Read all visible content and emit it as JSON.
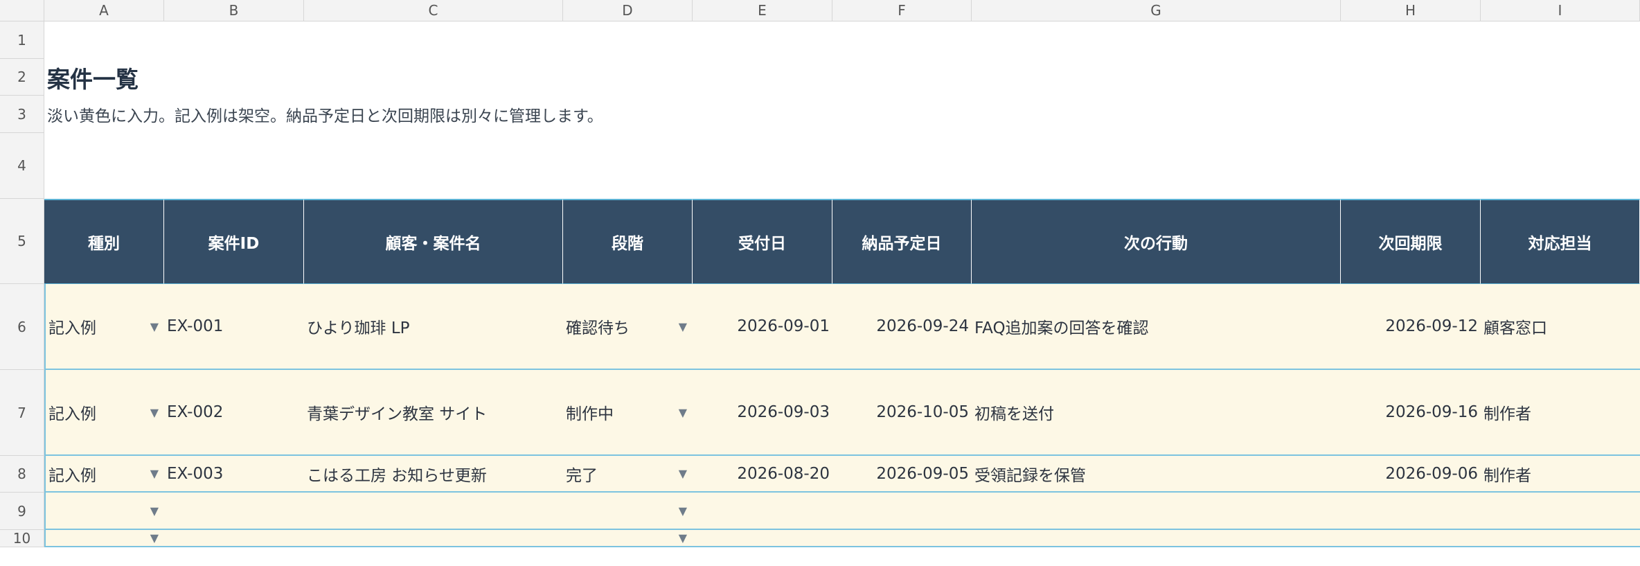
{
  "columns": [
    "A",
    "B",
    "C",
    "D",
    "E",
    "F",
    "G",
    "H",
    "I"
  ],
  "rows": [
    "1",
    "2",
    "3",
    "4",
    "5",
    "6",
    "7",
    "8",
    "9",
    "10"
  ],
  "title": "案件一覧",
  "note": "淡い黄色に入力。記入例は架空。納品予定日と次回期限は別々に管理します。",
  "headers": {
    "type": "種別",
    "case_id": "案件ID",
    "customer": "顧客・案件名",
    "stage": "段階",
    "received": "受付日",
    "delivery": "納品予定日",
    "next_action": "次の行動",
    "next_deadline": "次回期限",
    "owner": "対応担当"
  },
  "records": [
    {
      "type": "記入例",
      "case_id": "EX-001",
      "customer": "ひより珈琲 LP",
      "stage": "確認待ち",
      "received": "2026-09-01",
      "delivery": "2026-09-24",
      "next_action": "FAQ追加案の回答を確認",
      "next_deadline": "2026-09-12",
      "owner": "顧客窓口"
    },
    {
      "type": "記入例",
      "case_id": "EX-002",
      "customer": "青葉デザイン教室 サイト",
      "stage": "制作中",
      "received": "2026-09-03",
      "delivery": "2026-10-05",
      "next_action": "初稿を送付",
      "next_deadline": "2026-09-16",
      "owner": "制作者"
    },
    {
      "type": "記入例",
      "case_id": "EX-003",
      "customer": "こはる工房 お知らせ更新",
      "stage": "完了",
      "received": "2026-08-20",
      "delivery": "2026-09-05",
      "next_action": "受領記録を保管",
      "next_deadline": "2026-09-06",
      "owner": "制作者"
    }
  ],
  "dropdown_icon": "chevron-down-icon",
  "colors": {
    "header_bg": "#344d66",
    "input_bg": "#fdf8e6",
    "border_accent": "#7cc3df"
  }
}
